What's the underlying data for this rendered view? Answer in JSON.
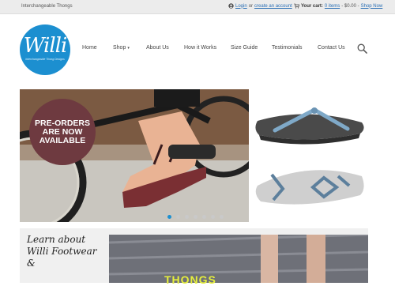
{
  "topbar": {
    "tagline": "Interchangeable Thongs",
    "login": "Login",
    "or_text": "or",
    "create_account": "create an account",
    "cart_label": "Your cart:",
    "cart_count": "0 items",
    "cart_total": "- $0.00 -",
    "shop_now": "Shop Now"
  },
  "logo": {
    "word": "Willi",
    "subtitle": "Interchangeable Thong Designs"
  },
  "nav": {
    "home": "Home",
    "shop": "Shop",
    "shop_caret": "▾",
    "about": "About Us",
    "how": "How it Works",
    "size": "Size Guide",
    "testimonials": "Testimonials",
    "contact": "Contact Us"
  },
  "slider": {
    "badge_line1": "PRE-ORDERS",
    "badge_line2": "ARE NOW",
    "badge_line3": "AVAILABLE",
    "active_dot": 1,
    "dot_count": 7
  },
  "promo": {
    "handwriting_line1": "Learn about",
    "handwriting_line2": "Willi Footwear &",
    "photo_caption": "THONGS"
  },
  "colors": {
    "brand_blue": "#1c8fd0",
    "badge_maroon": "#6e3a40",
    "caption_yellow": "#e6ef3c"
  }
}
